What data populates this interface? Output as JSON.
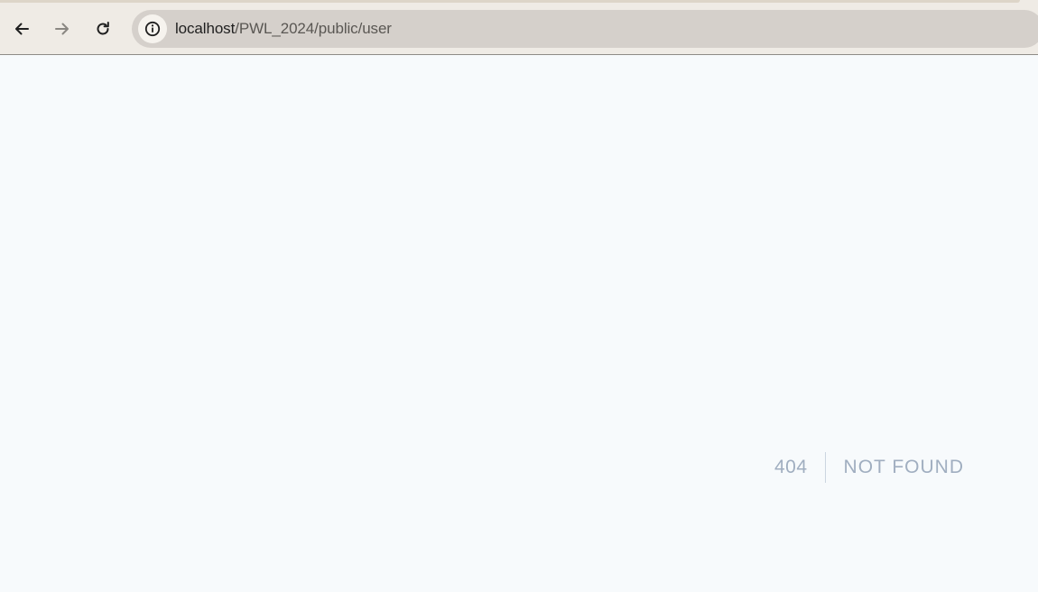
{
  "browser": {
    "url_host": "localhost",
    "url_path": "/PWL_2024/public/user",
    "icons": {
      "back": "back-arrow-icon",
      "forward": "forward-arrow-icon",
      "reload": "reload-icon",
      "site_info": "info-icon"
    },
    "colors": {
      "toolbar": "#efebe5",
      "omnibox": "#d5d0cb",
      "page_background": "#f7fafc"
    }
  },
  "page": {
    "error_code": "404",
    "error_message": "NOT FOUND",
    "colors": {
      "text": "#a0aec0",
      "divider": "#cbd5e0"
    }
  }
}
